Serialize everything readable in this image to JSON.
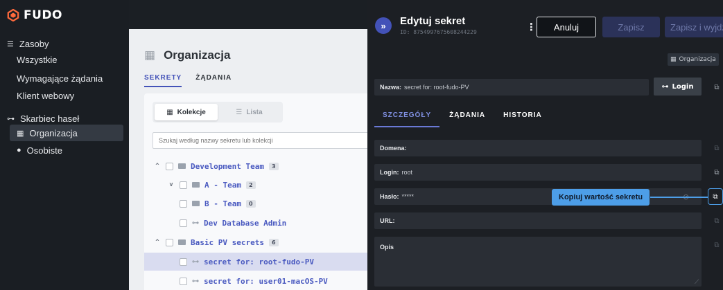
{
  "app": {
    "logo_text": "FUDO"
  },
  "sidebar": {
    "resources_label": "Zasoby",
    "resources_items": [
      "Wszystkie",
      "Wymagające żądania",
      "Klient webowy"
    ],
    "vault_label": "Skarbiec haseł",
    "vault_items": [
      "Organizacja",
      "Osobiste"
    ]
  },
  "main": {
    "title": "Organizacja",
    "tabs": [
      "SEKRETY",
      "ŻĄDANIA"
    ],
    "view_toggle": [
      "Kolekcje",
      "Lista"
    ],
    "search_placeholder": "Szukaj według nazwy sekretu lub kolekcji",
    "tree": [
      {
        "label": "Development Team",
        "count": "3",
        "type": "folder",
        "chevron": "^"
      },
      {
        "label": "A - Team",
        "count": "2",
        "type": "folder",
        "chevron": "v"
      },
      {
        "label": "B - Team",
        "count": "0",
        "type": "folder",
        "chevron": ""
      },
      {
        "label": "Dev Database Admin",
        "count": "",
        "type": "secret",
        "chevron": ""
      },
      {
        "label": "Basic PV secrets",
        "count": "6",
        "type": "folder",
        "chevron": "^"
      },
      {
        "label": "secret for: root-fudo-PV",
        "count": "",
        "type": "secret",
        "chevron": ""
      },
      {
        "label": "secret for: user01-macOS-PV",
        "count": "",
        "type": "secret",
        "chevron": ""
      }
    ]
  },
  "drawer": {
    "title": "Edytuj sekret",
    "id": "ID: 8754997675608244229",
    "cancel_label": "Anuluj",
    "save_label": "Zapisz",
    "save_exit_label": "Zapisz i wyjdź",
    "org_badge": "Organizacja",
    "name_label": "Nazwa:",
    "name_value": "secret for: root-fudo-PV",
    "login_button": "Login",
    "tabs": [
      "SZCZEGÓŁY",
      "ŻĄDANIA",
      "HISTORIA"
    ],
    "fields": {
      "domain_label": "Domena:",
      "domain_value": "",
      "login_label": "Login:",
      "login_value": "root",
      "password_label": "Hasło:",
      "password_value": "*****",
      "url_label": "URL:",
      "url_value": "",
      "desc_label": "Opis",
      "desc_value": ""
    },
    "tooltip": "Kopiuj wartość sekretu"
  },
  "colors": {
    "accent": "#4352b8",
    "tooltip": "#4d9ee8",
    "logo": "#ff6a3d",
    "drawer_bg": "#1c1f24"
  }
}
